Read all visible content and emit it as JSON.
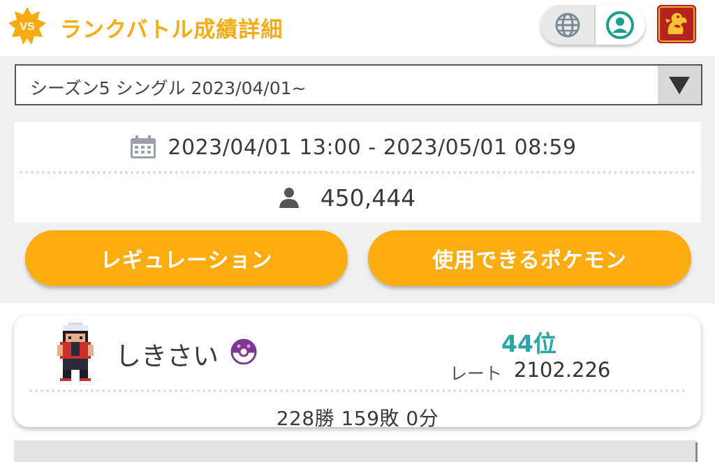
{
  "header": {
    "title": "ランクバトル成績詳細",
    "badge_text": "VS",
    "icons": [
      "vs-badge-icon",
      "globe-icon",
      "user-profile-icon",
      "dragon-emblem-icon"
    ]
  },
  "season_select": {
    "selected": "シーズン5 シングル 2023/04/01~"
  },
  "season_info": {
    "period": "2023/04/01 13:00 - 2023/05/01 08:59",
    "players": "450,444"
  },
  "buttons": {
    "regulation": "レギュレーション",
    "usable_pokemon": "使用できるポケモン"
  },
  "player": {
    "name": "しきさい",
    "rank": "44位",
    "rate_label": "レート",
    "rate": "2102.226",
    "record": "228勝 159敗 0分"
  },
  "colors": {
    "accent": "#fbac11",
    "title": "#f7ab10",
    "rank": "#2aa6a6",
    "ball": "#7b3a8f",
    "emblem": "#b5221f"
  }
}
